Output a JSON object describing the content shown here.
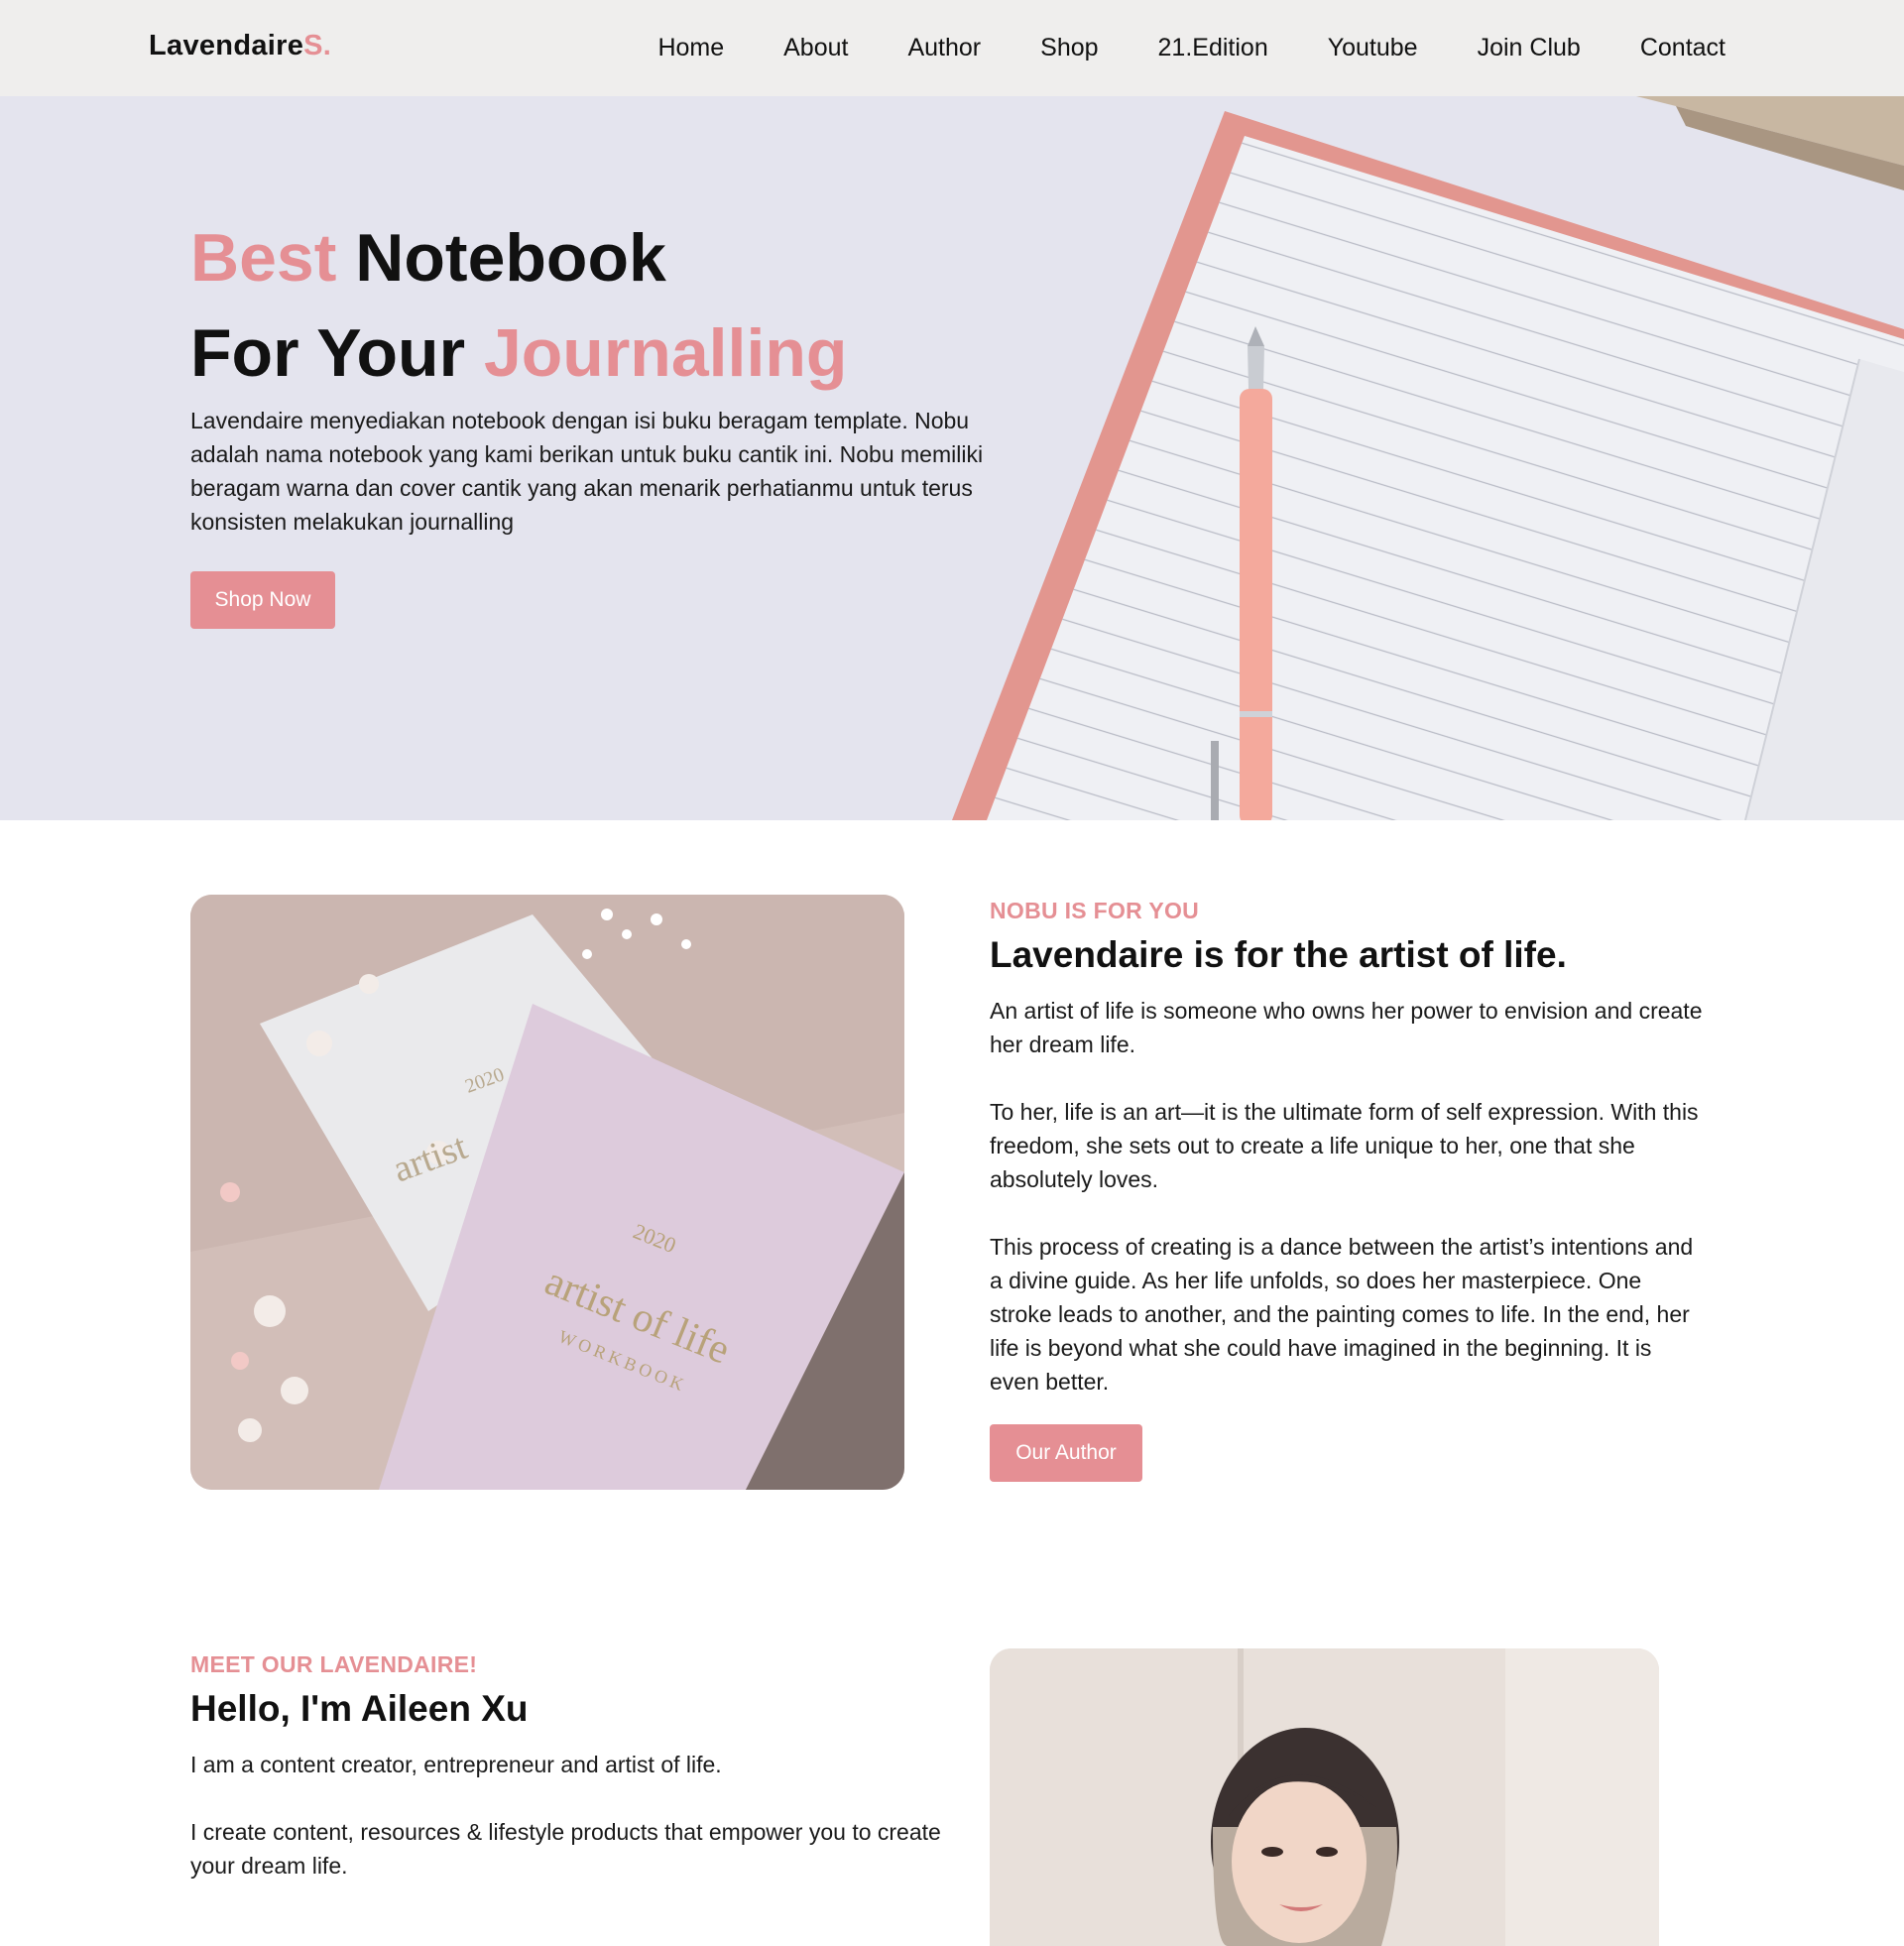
{
  "brand": {
    "logo_main": "Lavendaire",
    "logo_accent": "S."
  },
  "nav": {
    "items": [
      "Home",
      "About",
      "Author",
      "Shop",
      "21.Edition",
      "Youtube",
      "Join Club",
      "Contact"
    ]
  },
  "hero": {
    "title_accent_1": "Best",
    "title_part_1": " Notebook",
    "title_part_2": "For Your ",
    "title_accent_2": "Journalling",
    "description": "Lavendaire menyediakan notebook dengan isi buku beragam template. Nobu adalah nama notebook yang kami berikan untuk buku cantik ini. Nobu memiliki beragam warna dan cover cantik yang akan menarik perhatianmu untuk terus konsisten melakukan journalling",
    "button_label": "Shop Now"
  },
  "about": {
    "kicker": "NOBU IS FOR YOU",
    "title": "Lavendaire is for the artist of life.",
    "paragraph_1": "An artist of life is someone who owns her power to envision and create her dream life.",
    "paragraph_2": "To her, life is an art—it is the ultimate form of self expression. With this freedom, she sets out to create a life unique to her, one that she absolutely loves.",
    "paragraph_3": "This process of creating is a dance between the artist’s intentions and a divine guide. As her life unfolds, so does her masterpiece. One stroke leads to another, and the painting comes to life. In the end, her life is beyond what she could have imagined in the beginning. It is even better.",
    "button_label": "Our Author",
    "image": {
      "book_year": "2020",
      "book_title": "artist of life",
      "book_subtitle": "WORKBOOK"
    }
  },
  "author": {
    "kicker": "MEET OUR LAVENDAIRE!",
    "title": "Hello, I'm Aileen Xu",
    "paragraph_1": "I am a content creator, entrepreneur and artist of life.",
    "paragraph_2": "I create content, resources & lifestyle products that empower you to create your dream life."
  },
  "colors": {
    "accent": "#e58f94",
    "navbar_bg": "#efeeed",
    "hero_bg": "#e4e4ee"
  }
}
